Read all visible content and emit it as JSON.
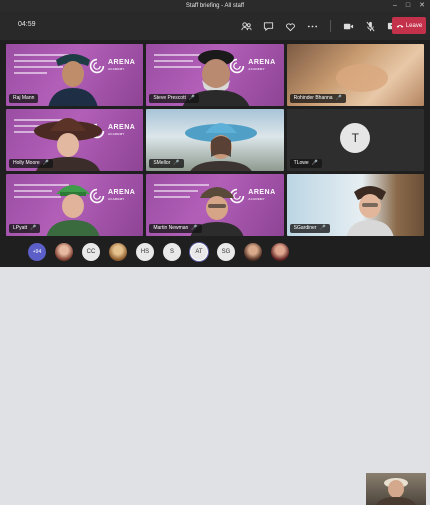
{
  "window": {
    "title": "Staff briefing - All staff"
  },
  "toolbar": {
    "timer": "04:59",
    "leave_label": "Leave",
    "icons": [
      "people-icon",
      "chat-icon",
      "reactions-icon",
      "more-icon",
      "camera-icon",
      "mic-icon",
      "share-icon"
    ]
  },
  "colors": {
    "leave": "#c4314b",
    "slide_purple": "#a653ad",
    "accent": "#6264a7"
  },
  "slide": {
    "brand": "ARENA",
    "brand_sub": "ACADEMY"
  },
  "participants": [
    {
      "name": "Raj Mann",
      "muted": false
    },
    {
      "name": "Steve Prescott",
      "muted": true
    },
    {
      "name": "Rohinder Bhanna",
      "muted": true
    },
    {
      "name": "Holly Moore",
      "muted": true
    },
    {
      "name": "SMellor",
      "muted": true
    },
    {
      "name": "TLowe",
      "muted": true,
      "initial": "T"
    },
    {
      "name": "LPyatt",
      "muted": true
    },
    {
      "name": "Martin Newman",
      "muted": true
    },
    {
      "name": "SGardiner",
      "muted": true
    }
  ],
  "strip": [
    {
      "label": "+94",
      "kind": "more"
    },
    {
      "label": "",
      "kind": "photo1"
    },
    {
      "label": "CC",
      "kind": "initials"
    },
    {
      "label": "",
      "kind": "photo2"
    },
    {
      "label": "HS",
      "kind": "initials"
    },
    {
      "label": "S",
      "kind": "initials"
    },
    {
      "label": "AT",
      "kind": "initials"
    },
    {
      "label": "SG",
      "kind": "initials"
    },
    {
      "label": "",
      "kind": "photo3"
    },
    {
      "label": "",
      "kind": "photo4"
    }
  ]
}
